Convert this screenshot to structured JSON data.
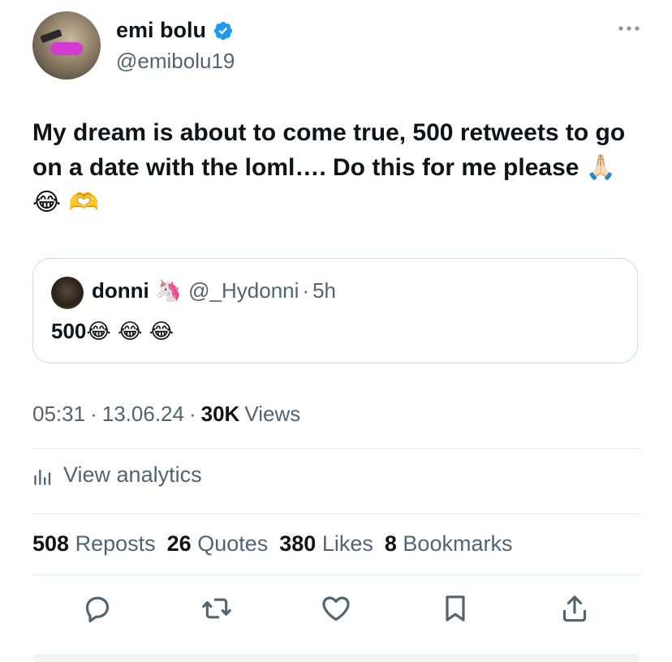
{
  "author": {
    "display_name": "emi bolu",
    "handle": "@emibolu19",
    "verified": true
  },
  "tweet": {
    "text": "My dream is about to come true, 500 retweets to go on a date with the loml…. Do this for me please",
    "emojis": "🙏🏻 😂 🫶"
  },
  "quoted_tweet": {
    "display_name": "donni",
    "name_emoji": "🦄",
    "handle": "@_Hydonni",
    "separator": "·",
    "time": "5h",
    "text": "500",
    "emojis": "😂 😂 😂"
  },
  "meta": {
    "time": "05:31",
    "sep1": "·",
    "date": "13.06.24",
    "sep2": "·",
    "views_count": "30K",
    "views_label": "Views"
  },
  "analytics": {
    "label": "View analytics"
  },
  "stats": [
    {
      "count": "508",
      "label": "Reposts"
    },
    {
      "count": "26",
      "label": "Quotes"
    },
    {
      "count": "380",
      "label": "Likes"
    },
    {
      "count": "8",
      "label": "Bookmarks"
    }
  ],
  "colors": {
    "text": "#0f1419",
    "secondary": "#536471",
    "verified": "#1d9bf0",
    "border": "#cfd9de"
  },
  "icons": {
    "verified": "verified-badge-icon",
    "more": "more-options-icon",
    "analytics": "analytics-bars-icon",
    "reply": "reply-bubble-icon",
    "repost": "repost-arrows-icon",
    "like": "heart-icon",
    "bookmark": "bookmark-icon",
    "share": "share-upload-icon"
  }
}
